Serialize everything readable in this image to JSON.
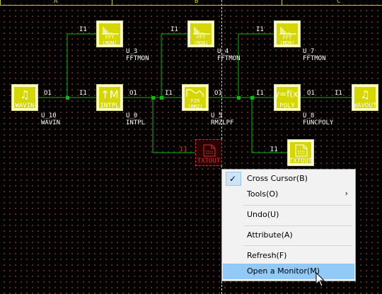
{
  "ruler": {
    "columns": [
      "A",
      "B",
      "C"
    ]
  },
  "blocks": {
    "wavin": {
      "caption": "WAVIN",
      "name": "U_10",
      "type": "WAVIN"
    },
    "intpl": {
      "caption": "INTPL",
      "name": "U_0",
      "type": "INTPL"
    },
    "fir": {
      "caption_top": "FIR",
      "caption_bot": "(RMZ)",
      "name": "U_5",
      "type": "RMZLPF"
    },
    "poly": {
      "caption": "POLY",
      "name": "U_8",
      "type": "FUNCPOLY"
    },
    "wavout": {
      "caption": "WAVOUT"
    },
    "fft1": {
      "caption_top": "FFT",
      "caption_bot": "(MON)",
      "name": "U_3",
      "type": "FFTMON"
    },
    "fft2": {
      "caption_top": "FFT",
      "caption_bot": "(MON)",
      "name": "U_4",
      "type": "FFTMON"
    },
    "fft3": {
      "caption_top": "FFT",
      "caption_bot": "(MON)",
      "name": "U_7",
      "type": "FFTMON"
    },
    "txtout1": {
      "caption": "TXTOUT"
    },
    "txtout2": {
      "caption": "TXTOUT"
    }
  },
  "ports": {
    "in": "I1",
    "out": "O1"
  },
  "context_menu": {
    "items": [
      {
        "label": "Cross Cursor(B)",
        "checked": true
      },
      {
        "label": "Tools(O)",
        "submenu": true
      },
      {
        "label": "Undo(U)"
      },
      {
        "label": "Attribute(A)"
      },
      {
        "label": "Refresh(F)"
      },
      {
        "label": "Open a Monitor(M)",
        "highlighted": true
      }
    ]
  },
  "colors": {
    "wire": "#00c000",
    "block_fill": "#d6d600",
    "selected": "#d03030",
    "menu_highlight": "#91c9f7"
  }
}
